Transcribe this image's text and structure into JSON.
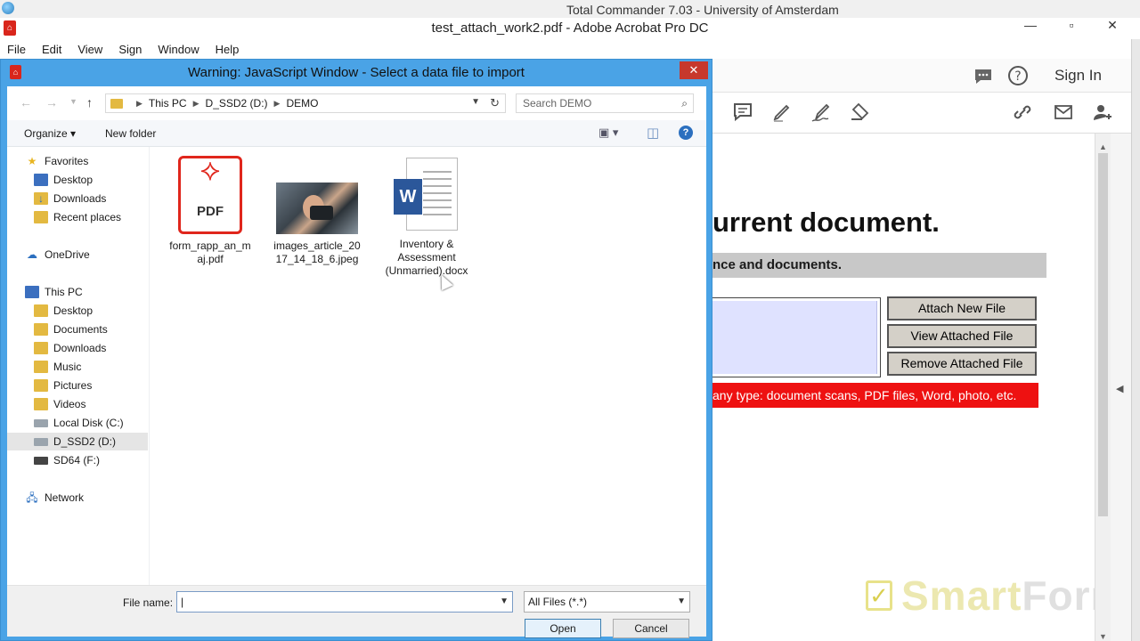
{
  "background_window": {
    "title": "Total Commander 7.03 - University of Amsterdam"
  },
  "acrobat": {
    "title": "test_attach_work2.pdf - Adobe Acrobat Pro DC",
    "menu": [
      "File",
      "Edit",
      "View",
      "Sign",
      "Window",
      "Help"
    ],
    "sign_in": "Sign In",
    "document": {
      "heading": "urrent document.",
      "subheading": "nce and documents.",
      "buttons": {
        "attach": "Attach New File",
        "view": "View Attached File",
        "remove": "Remove Attached File"
      },
      "note": "any type: document scans, PDF files, Word, photo, etc.",
      "brand": {
        "part1": "Smart",
        "part2": "Form"
      }
    }
  },
  "dialog": {
    "title": "Warning: JavaScript Window - Select a data file to import",
    "breadcrumb": [
      "This PC",
      "D_SSD2 (D:)",
      "DEMO"
    ],
    "search_placeholder": "Search DEMO",
    "toolbar": {
      "organize": "Organize",
      "new_folder": "New folder"
    },
    "nav": {
      "favorites": "Favorites",
      "fav_items": [
        "Desktop",
        "Downloads",
        "Recent places"
      ],
      "onedrive": "OneDrive",
      "thispc": "This PC",
      "pc_items": [
        "Desktop",
        "Documents",
        "Downloads",
        "Music",
        "Pictures",
        "Videos",
        "Local Disk (C:)",
        "D_SSD2 (D:)",
        "SD64 (F:)"
      ],
      "network": "Network",
      "selected": "D_SSD2 (D:)"
    },
    "files": [
      {
        "name": "form_rapp_an_m aj.pdf",
        "line1": "form_rapp_an_m",
        "line2": "aj.pdf",
        "type": "pdf"
      },
      {
        "name": "images_article_20 17_14_18_6.jpeg",
        "line1": "images_article_20",
        "line2": "17_14_18_6.jpeg",
        "type": "jpeg"
      },
      {
        "name": "Inventory & Assessment (Unmarried).docx",
        "line1": "Inventory &",
        "line2": "Assessment",
        "line3": "(Unmarried).docx",
        "type": "docx"
      }
    ],
    "file_name_label": "File name:",
    "file_name_value": "",
    "file_type": "All Files (*.*)",
    "open_label": "Open",
    "cancel_label": "Cancel"
  }
}
